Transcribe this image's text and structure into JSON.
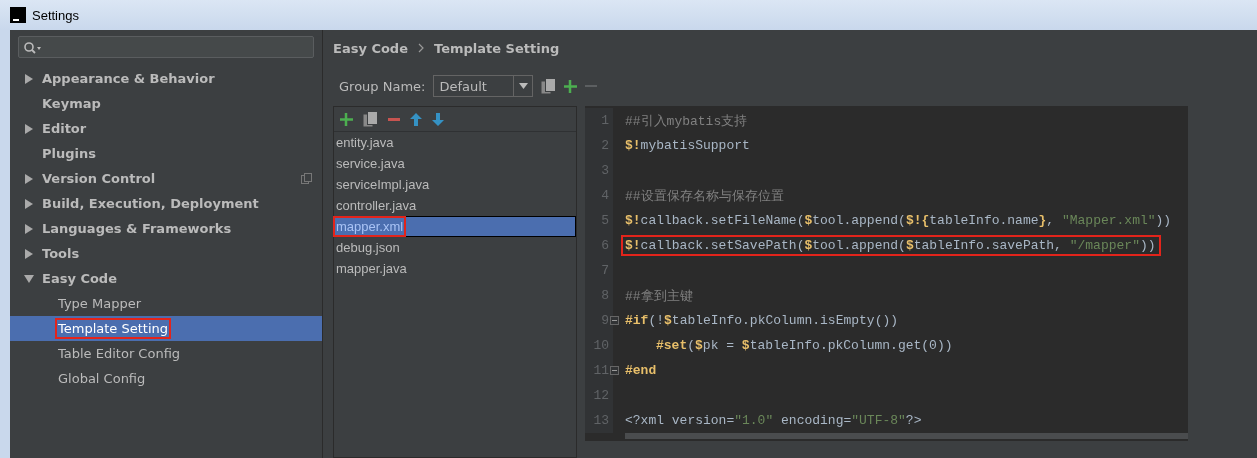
{
  "window": {
    "title": "Settings"
  },
  "sidebar": {
    "items": [
      {
        "label": "Appearance & Behavior",
        "expandable": true,
        "expanded": false,
        "selected": false,
        "annotated": false,
        "badge": false
      },
      {
        "label": "Keymap",
        "expandable": false,
        "selected": false,
        "annotated": false,
        "badge": false
      },
      {
        "label": "Editor",
        "expandable": true,
        "expanded": false,
        "selected": false,
        "annotated": false,
        "badge": false
      },
      {
        "label": "Plugins",
        "expandable": false,
        "selected": false,
        "annotated": false,
        "badge": false
      },
      {
        "label": "Version Control",
        "expandable": true,
        "expanded": false,
        "selected": false,
        "annotated": false,
        "badge": true
      },
      {
        "label": "Build, Execution, Deployment",
        "expandable": true,
        "expanded": false,
        "selected": false,
        "annotated": false,
        "badge": false
      },
      {
        "label": "Languages & Frameworks",
        "expandable": true,
        "expanded": false,
        "selected": false,
        "annotated": false,
        "badge": false
      },
      {
        "label": "Tools",
        "expandable": true,
        "expanded": false,
        "selected": false,
        "annotated": false,
        "badge": false
      },
      {
        "label": "Easy Code",
        "expandable": true,
        "expanded": true,
        "selected": false,
        "annotated": false,
        "badge": false,
        "children": [
          {
            "label": "Type Mapper",
            "selected": false,
            "annotated": false
          },
          {
            "label": "Template Setting",
            "selected": true,
            "annotated": true
          },
          {
            "label": "Table Editor Config",
            "selected": false,
            "annotated": false
          },
          {
            "label": "Global Config",
            "selected": false,
            "annotated": false
          }
        ]
      }
    ]
  },
  "breadcrumb": [
    "Easy Code",
    "Template Setting"
  ],
  "group": {
    "label": "Group Name:",
    "value": "Default"
  },
  "templates": [
    {
      "name": "entity.java",
      "selected": false,
      "annotated": false
    },
    {
      "name": "service.java",
      "selected": false,
      "annotated": false
    },
    {
      "name": "serviceImpl.java",
      "selected": false,
      "annotated": false
    },
    {
      "name": "controller.java",
      "selected": false,
      "annotated": false
    },
    {
      "name": "mapper.xml",
      "selected": true,
      "annotated": true
    },
    {
      "name": "debug.json",
      "selected": false,
      "annotated": false
    },
    {
      "name": "mapper.java",
      "selected": false,
      "annotated": false
    }
  ],
  "editor": {
    "lines": [
      {
        "number": "1",
        "fold": false,
        "annotated": false,
        "tokens": [
          {
            "kind": "comment",
            "text": "##引入mybatis支持"
          }
        ]
      },
      {
        "number": "2",
        "fold": false,
        "annotated": false,
        "tokens": [
          {
            "kind": "macro",
            "text": "$!"
          },
          {
            "kind": "plain",
            "text": "mybatisSupport"
          }
        ]
      },
      {
        "number": "3",
        "fold": false
      },
      {
        "number": "4",
        "fold": false,
        "annotated": false,
        "tokens": [
          {
            "kind": "comment",
            "text": "##设置保存名称与保存位置"
          }
        ]
      },
      {
        "number": "5",
        "fold": false,
        "annotated": false,
        "tokens": [
          {
            "kind": "macro",
            "text": "$!"
          },
          {
            "kind": "plain",
            "text": "callback.setFileName("
          },
          {
            "kind": "macro",
            "text": "$"
          },
          {
            "kind": "plain",
            "text": "tool.append("
          },
          {
            "kind": "macro",
            "text": "$!{"
          },
          {
            "kind": "plain",
            "text": "tableInfo.name"
          },
          {
            "kind": "macro",
            "text": "}"
          },
          {
            "kind": "plain",
            "text": ", "
          },
          {
            "kind": "string",
            "text": "\"Mapper.xml\""
          },
          {
            "kind": "plain",
            "text": "))"
          }
        ]
      },
      {
        "number": "6",
        "fold": false,
        "annotated": true,
        "tokens": [
          {
            "kind": "macro",
            "text": "$!"
          },
          {
            "kind": "plain",
            "text": "callback.setSavePath("
          },
          {
            "kind": "macro",
            "text": "$"
          },
          {
            "kind": "plain",
            "text": "tool.append("
          },
          {
            "kind": "macro",
            "text": "$"
          },
          {
            "kind": "plain",
            "text": "tableInfo.savePath, "
          },
          {
            "kind": "string",
            "text": "\"/mapper\""
          },
          {
            "kind": "plain",
            "text": "))"
          }
        ]
      },
      {
        "number": "7",
        "fold": false
      },
      {
        "number": "8",
        "fold": false,
        "annotated": false,
        "tokens": [
          {
            "kind": "comment",
            "text": "##拿到主键"
          }
        ]
      },
      {
        "number": "9",
        "fold": true,
        "annotated": false,
        "tokens": [
          {
            "kind": "macro",
            "text": "#if"
          },
          {
            "kind": "plain",
            "text": "(!"
          },
          {
            "kind": "macro",
            "text": "$"
          },
          {
            "kind": "plain",
            "text": "tableInfo.pkColumn.isEmpty())"
          }
        ]
      },
      {
        "number": "10",
        "fold": false,
        "annotated": false,
        "indented": true,
        "tokens": [
          {
            "kind": "macro",
            "text": "#set"
          },
          {
            "kind": "plain",
            "text": "("
          },
          {
            "kind": "macro",
            "text": "$"
          },
          {
            "kind": "plain",
            "text": "pk = "
          },
          {
            "kind": "macro",
            "text": "$"
          },
          {
            "kind": "plain",
            "text": "tableInfo.pkColumn.get(0))"
          }
        ]
      },
      {
        "number": "11",
        "fold": true,
        "annotated": false,
        "tokens": [
          {
            "kind": "macro",
            "text": "#end"
          }
        ]
      },
      {
        "number": "12",
        "fold": false
      },
      {
        "number": "13",
        "fold": false,
        "annotated": false,
        "tokens": [
          {
            "kind": "plain",
            "text": "<?xml version="
          },
          {
            "kind": "string",
            "text": "\"1.0\""
          },
          {
            "kind": "plain",
            "text": " encoding="
          },
          {
            "kind": "string",
            "text": "\"UTF-8\""
          },
          {
            "kind": "plain",
            "text": "?>"
          }
        ]
      }
    ]
  }
}
